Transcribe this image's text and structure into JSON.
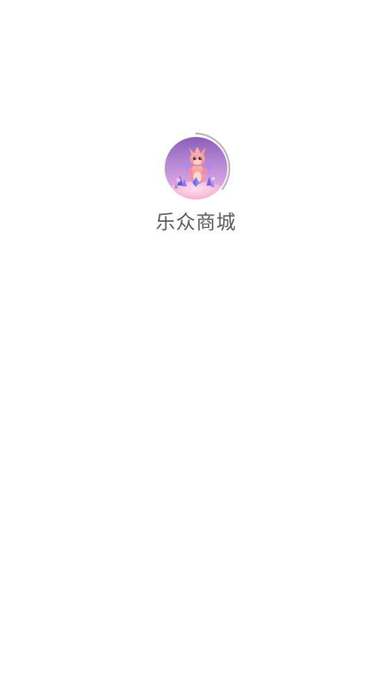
{
  "app": {
    "name": "乐众商城"
  },
  "splash": {
    "icon": "dragon-mascot-icon",
    "spinner": "loading-spinner-icon",
    "spinner_color": "#b5b5b5",
    "background": "#ffffff"
  }
}
